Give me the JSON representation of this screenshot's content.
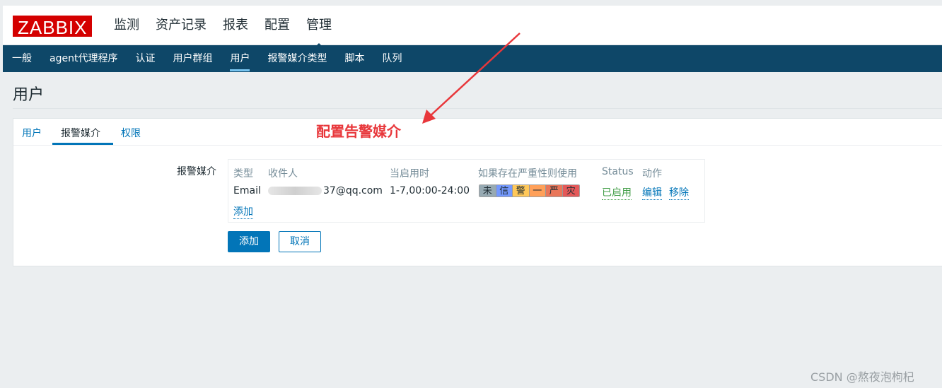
{
  "header": {
    "logo": "ZABBIX",
    "menu": [
      "监测",
      "资产记录",
      "报表",
      "配置",
      "管理"
    ],
    "active_menu": "管理"
  },
  "submenu": {
    "items": [
      "一般",
      "agent代理程序",
      "认证",
      "用户群组",
      "用户",
      "报警媒介类型",
      "脚本",
      "队列"
    ],
    "active": "用户"
  },
  "page": {
    "title": "用户"
  },
  "tabs": {
    "items": [
      "用户",
      "报警媒介",
      "权限"
    ],
    "active": "报警媒介"
  },
  "annotation": {
    "text": "配置告警媒介",
    "color": "#e8373b"
  },
  "form": {
    "label": "报警媒介",
    "columns": [
      "类型",
      "收件人",
      "当启用时",
      "如果存在严重性则使用",
      "Status",
      "动作"
    ],
    "row": {
      "type": "Email",
      "recipient_visible": "37@qq.com",
      "when_active": "1-7,00:00-24:00",
      "severities": [
        {
          "label": "未",
          "color": "#97aab3"
        },
        {
          "label": "信",
          "color": "#7499ff"
        },
        {
          "label": "警",
          "color": "#ffc859"
        },
        {
          "label": "一",
          "color": "#ffa059"
        },
        {
          "label": "严",
          "color": "#e97659"
        },
        {
          "label": "灾",
          "color": "#e45959"
        }
      ],
      "status": "已启用",
      "action_edit": "编辑",
      "action_remove": "移除"
    },
    "add_link": "添加"
  },
  "buttons": {
    "add": "添加",
    "cancel": "取消"
  },
  "watermark": "CSDN @熬夜泡枸杞"
}
